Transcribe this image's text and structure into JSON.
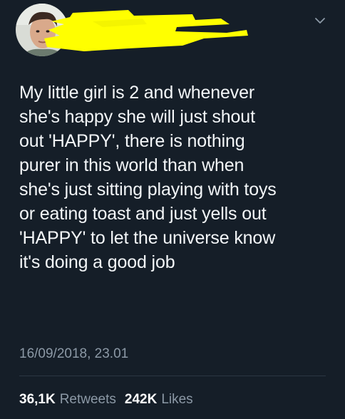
{
  "tweet": {
    "text": "My little girl is 2 and whenever\nshe's happy she will just shout\nout 'HAPPY', there is nothing\npurer in this world than when\nshe's just sitting playing with toys\nor eating toast and just yells out\n'HAPPY' to let the universe know\nit's doing a good job",
    "timestamp": "16/09/2018, 23.01",
    "retweets_count": "36,1K",
    "retweets_label": "Retweets",
    "likes_count": "242K",
    "likes_label": "Likes"
  },
  "icons": {
    "more_menu": "chevron-down-icon"
  },
  "colors": {
    "background": "#151e28",
    "text": "#f3f6f8",
    "secondary_text": "#8c99a6",
    "redaction": "#ffff00"
  }
}
